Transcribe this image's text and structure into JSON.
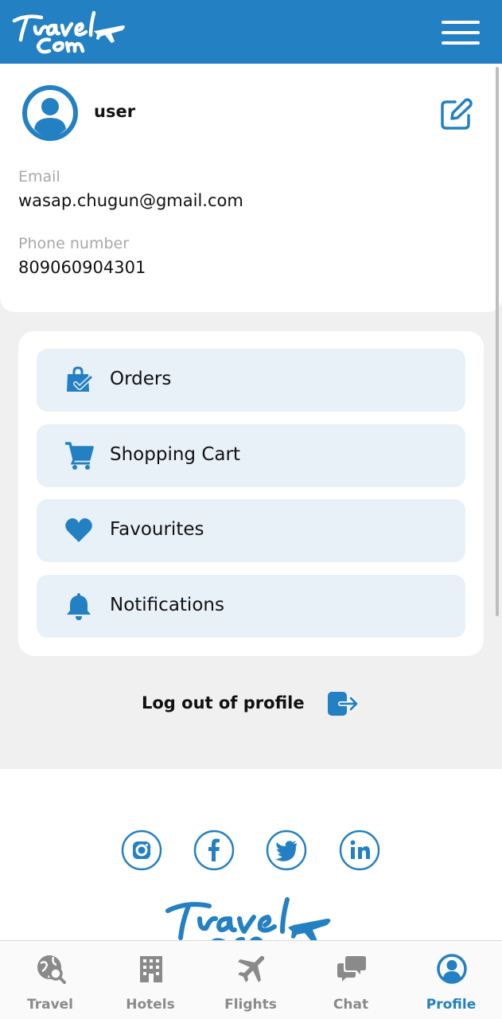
{
  "brand": {
    "name": "TravelCom",
    "color_primary": "#2380c3"
  },
  "header": {
    "menu_icon": "hamburger-menu-icon"
  },
  "profile": {
    "username": "user",
    "email_label": "Email",
    "email_value": "wasap.chugun@gmail.com",
    "phone_label": "Phone number",
    "phone_value": "809060904301",
    "edit_icon": "edit-icon"
  },
  "menu": {
    "items": [
      {
        "label": "Orders",
        "icon": "shopping-bag-check-icon"
      },
      {
        "label": "Shopping Cart",
        "icon": "cart-icon"
      },
      {
        "label": "Favourites",
        "icon": "heart-icon"
      },
      {
        "label": "Notifications",
        "icon": "bell-icon"
      }
    ]
  },
  "logout": {
    "label": "Log out of profile",
    "icon": "logout-icon"
  },
  "footer": {
    "social": [
      "instagram-icon",
      "facebook-icon",
      "twitter-icon",
      "linkedin-icon"
    ]
  },
  "tabbar": {
    "tabs": [
      {
        "label": "Travel",
        "icon": "globe-search-icon"
      },
      {
        "label": "Hotels",
        "icon": "hotel-building-icon"
      },
      {
        "label": "Flights",
        "icon": "airplane-icon"
      },
      {
        "label": "Chat",
        "icon": "chat-bubbles-icon"
      },
      {
        "label": "Profile",
        "icon": "user-circle-icon"
      }
    ],
    "active": "Profile",
    "active_color": "#2380c3",
    "inactive_color": "#8a8a8a"
  }
}
